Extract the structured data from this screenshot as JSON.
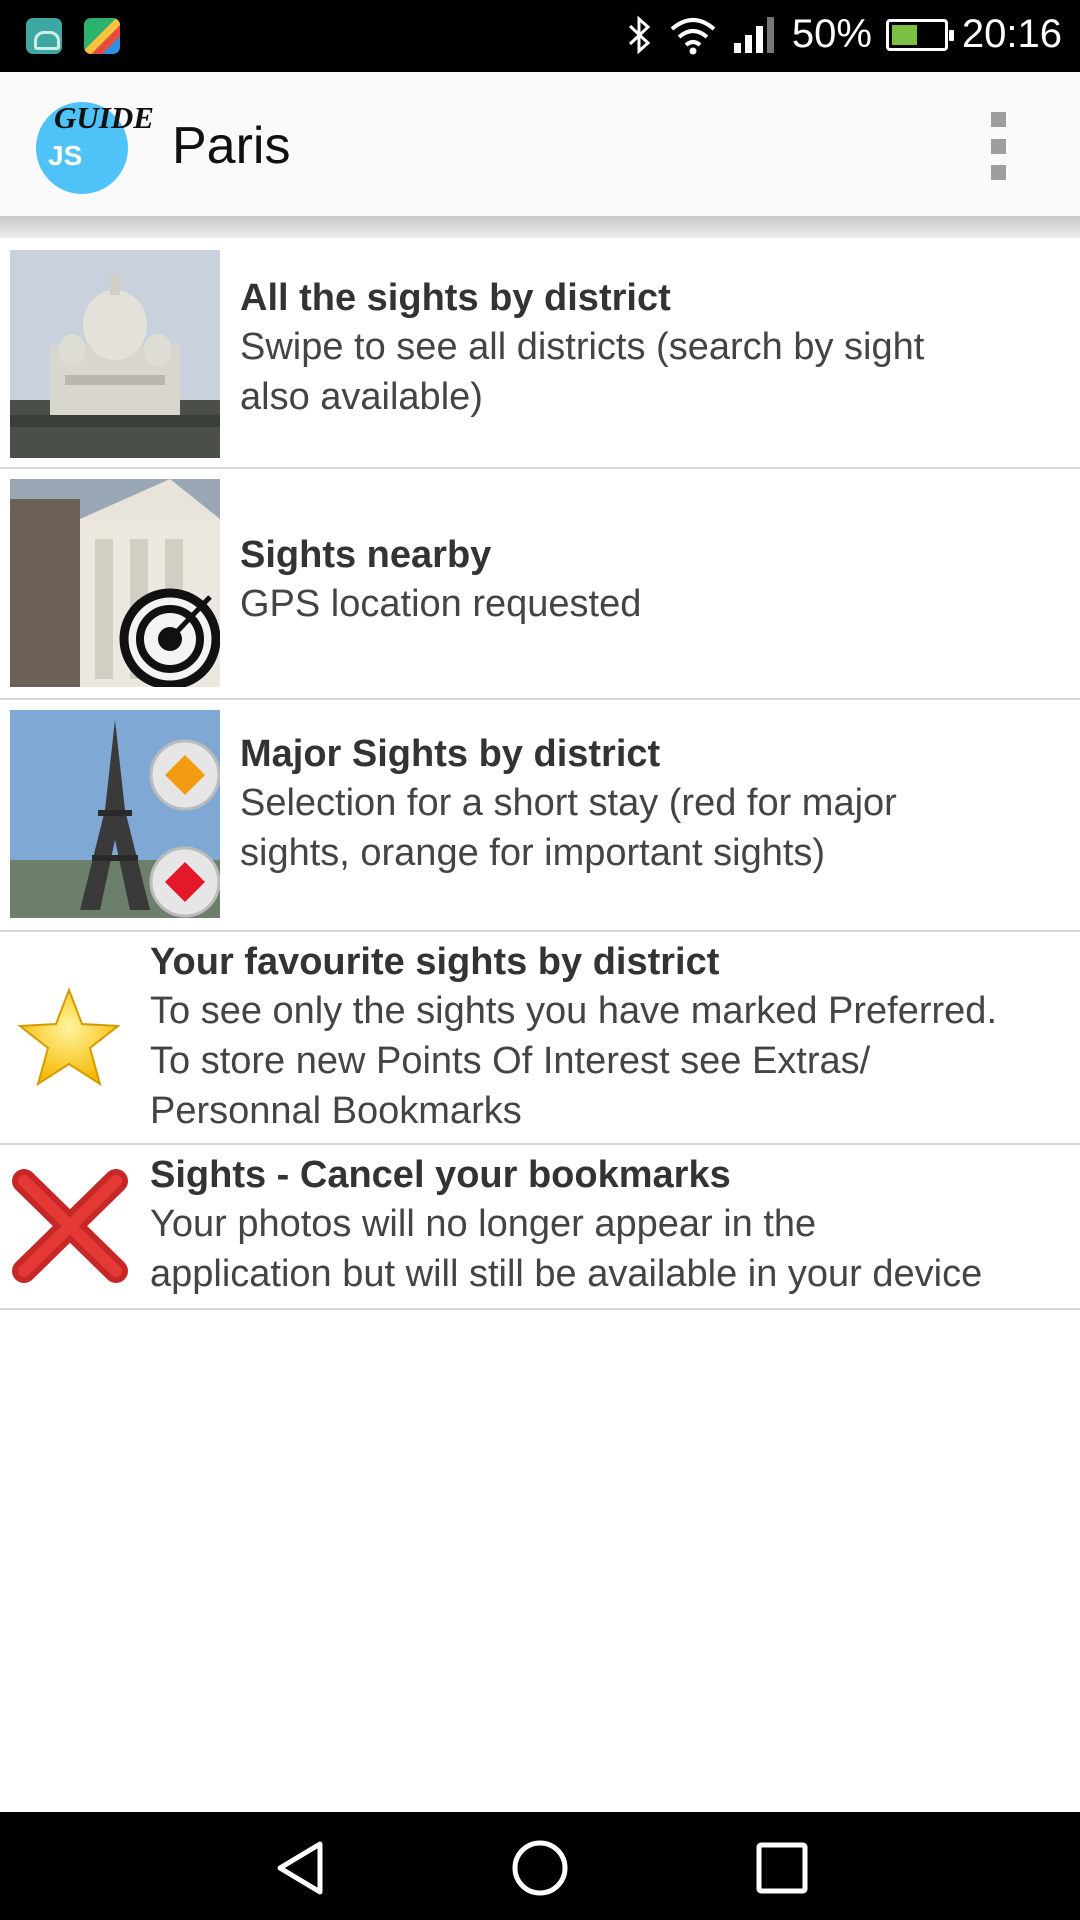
{
  "status_bar": {
    "notification_icons": [
      "android-icon",
      "play-store-icon"
    ],
    "battery_percent": "50%",
    "battery_level": 0.5,
    "time": "20:16"
  },
  "app_bar": {
    "logo_text_top": "GUIDE",
    "logo_text_bottom": "JS",
    "title": "Paris"
  },
  "menu_items": [
    {
      "title": "All the sights by district",
      "subtitle_lines": [
        "Swipe to see all districts (search by sight",
        "also available)"
      ],
      "icon": "sacre-coeur-photo"
    },
    {
      "title": "Sights nearby",
      "subtitle_lines": [
        "GPS location requested"
      ],
      "icon": "target-photo"
    },
    {
      "title": "Major Sights by district",
      "subtitle_lines": [
        "Selection for a short stay (red for major",
        "sights, orange for important sights)"
      ],
      "icon": "eiffel-tower-photo"
    },
    {
      "title": "Your favourite sights by district",
      "subtitle_lines": [
        "To see only the sights you have marked Preferred.",
        "To store new Points Of Interest see Extras/",
        "Personnal Bookmarks"
      ],
      "icon": "star-icon"
    },
    {
      "title": "Sights - Cancel your bookmarks",
      "subtitle_lines": [
        "Your photos will no longer appear in the",
        "application but will still be available in your device"
      ],
      "icon": "red-x-icon"
    }
  ],
  "colors": {
    "app_bar_bg": "#fafafa",
    "logo_circle": "#4fc3f7",
    "star": "#f5c518",
    "cancel_x": "#c62828",
    "divider": "#d6d6d6"
  }
}
